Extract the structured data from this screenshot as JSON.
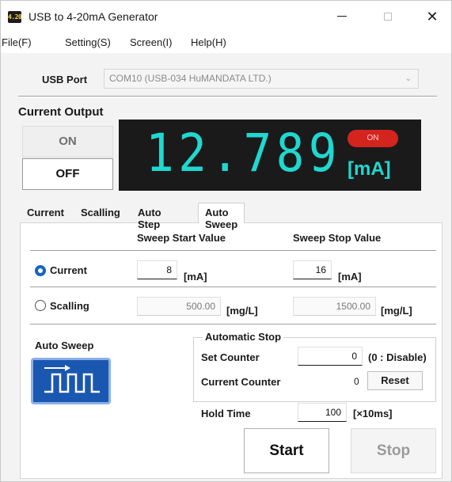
{
  "window": {
    "title": "USB to 4-20mA Generator",
    "app_icon_text": "4.20",
    "controls": {
      "minimize": "–",
      "maximize": "□",
      "close": "✕"
    }
  },
  "menu": {
    "items": [
      "File(F)",
      "Setting(S)",
      "Screen(I)",
      "Help(H)"
    ]
  },
  "usb": {
    "label": "USB Port",
    "selected": "COM10 (USB-034 HuMANDATA LTD.)",
    "chevron_icon": "chevron-down-icon"
  },
  "output": {
    "section_label": "Current Output",
    "on_label": "ON",
    "off_label": "OFF",
    "display_value": "12.789",
    "status_pill": "ON",
    "unit": "[mA]",
    "colors": {
      "segment": "#1fd8d0",
      "display_bg": "#1a1a1a",
      "pill": "#d4241e"
    }
  },
  "tabs": {
    "items": [
      "Current",
      "Scalling",
      "Auto Step",
      "Auto Sweep"
    ],
    "active": "Auto Sweep"
  },
  "sweep": {
    "start_header": "Sweep Start Value",
    "stop_header": "Sweep Stop Value",
    "current_row": {
      "label": "Current",
      "selected": true,
      "start": "8",
      "stop": "16",
      "unit": "[mA]"
    },
    "scalling_row": {
      "label": "Scalling",
      "selected": false,
      "start": "500.00",
      "stop": "1500.00",
      "unit": "[mg/L]"
    }
  },
  "auto_sweep": {
    "label": "Auto Sweep",
    "icon": "square-wave-icon",
    "automatic_stop": {
      "title": "Automatic Stop",
      "set_counter_label": "Set Counter",
      "set_counter_value": "0",
      "set_counter_hint": "(0 : Disable)",
      "current_counter_label": "Current Counter",
      "current_counter_value": "0",
      "reset_label": "Reset"
    },
    "hold_time_label": "Hold Time",
    "hold_time_value": "100",
    "hold_time_unit": "[×10ms]",
    "start_label": "Start",
    "stop_label": "Stop"
  }
}
